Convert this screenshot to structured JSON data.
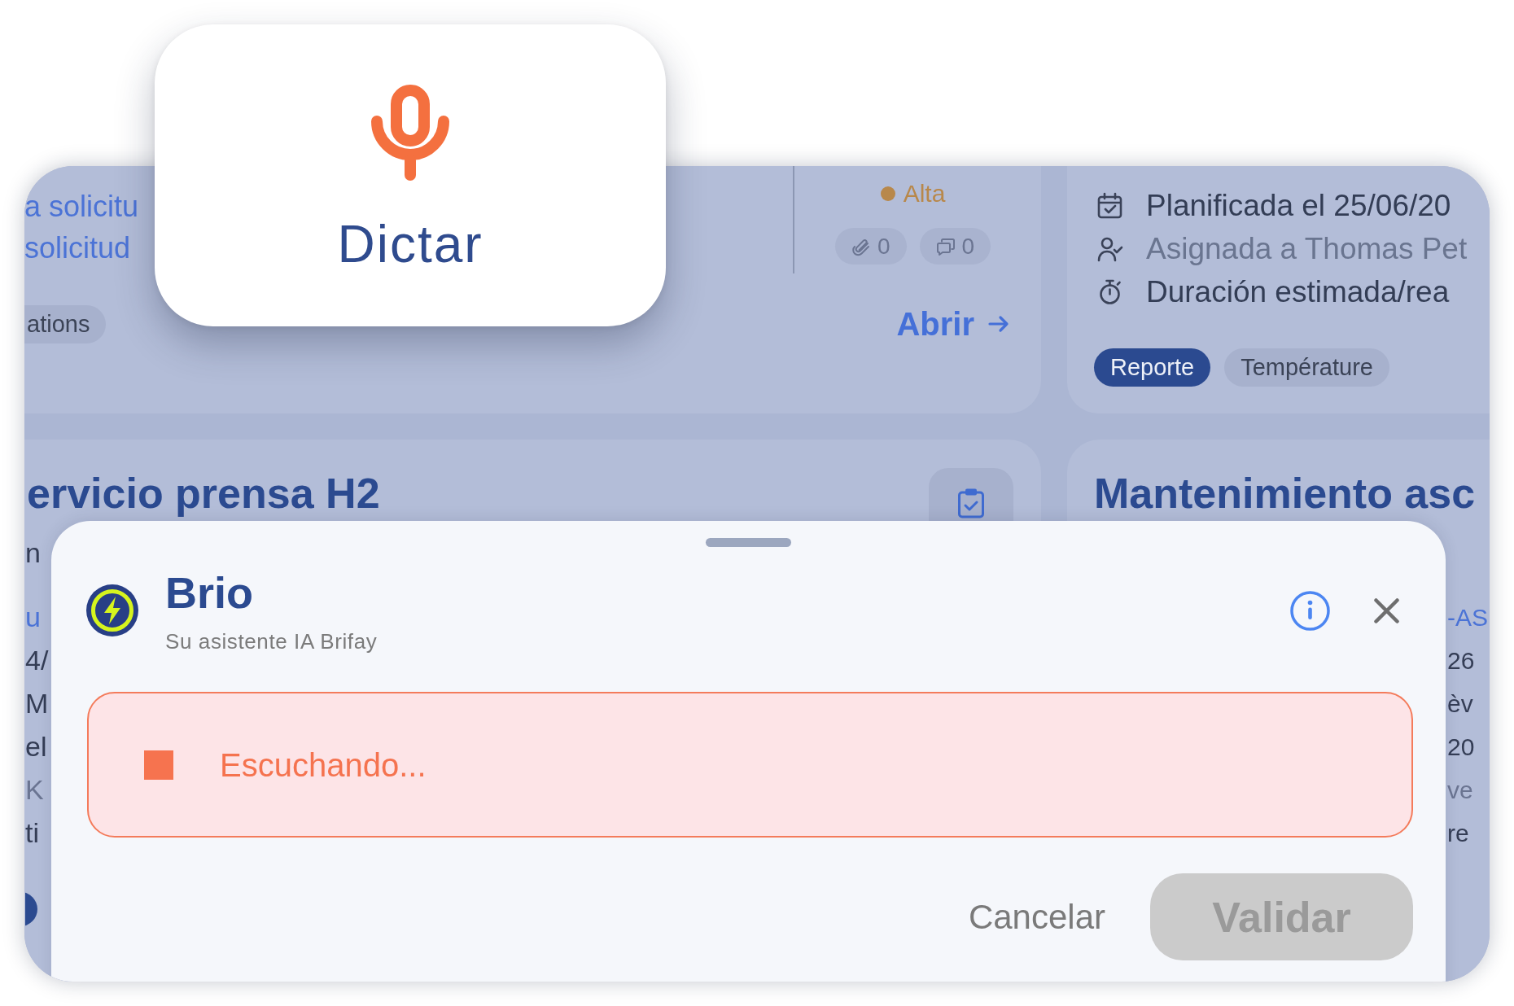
{
  "dictate_button": {
    "label": "Dictar"
  },
  "background_cards": {
    "top_left": {
      "links": [
        "a solicitu",
        "solicitud"
      ],
      "tags": [
        "ations"
      ],
      "priority": {
        "label": "Alta",
        "color": "#b8884b"
      },
      "counters": [
        {
          "kind": "attachments",
          "count": "0"
        },
        {
          "kind": "comments",
          "count": "0"
        }
      ],
      "open_link": "Abrir"
    },
    "top_right": {
      "details": [
        {
          "kind": "planned",
          "text": "Planificada el 25/06/20"
        },
        {
          "kind": "assignee",
          "text": "Asignada a Thomas Pet"
        },
        {
          "kind": "duration",
          "text": "Duración estimada/rea"
        }
      ],
      "tags": [
        {
          "label": "Reporte",
          "color": "#2b4a90"
        },
        {
          "label": "Température",
          "color": "#a7b1cd"
        }
      ]
    },
    "bottom_left": {
      "title": "ervicio prensa H2",
      "subtitle": "n",
      "lines": [
        {
          "kind": "link",
          "text": "u"
        },
        {
          "kind": "text",
          "text": "4/"
        },
        {
          "kind": "text",
          "text": "M"
        },
        {
          "kind": "text",
          "text": "el"
        },
        {
          "kind": "muted",
          "text": "K"
        },
        {
          "kind": "text",
          "text": "ti"
        }
      ]
    },
    "bottom_right": {
      "title": "Mantenimiento asc",
      "lines": [
        {
          "kind": "link",
          "text": "-AS"
        },
        {
          "kind": "text",
          "text": "26"
        },
        {
          "kind": "text",
          "text": "èv"
        },
        {
          "kind": "text",
          "text": "20"
        },
        {
          "kind": "muted",
          "text": "ve"
        },
        {
          "kind": "text",
          "text": "re"
        }
      ]
    }
  },
  "assistant_sheet": {
    "name": "Brio",
    "subtitle": "Su asistente IA Brifay",
    "dictation": {
      "recording": true,
      "status": "Escuchando..."
    },
    "actions": [
      {
        "kind": "cancel",
        "label": "Cancelar",
        "disabled": false
      },
      {
        "kind": "confirm",
        "label": "Validar",
        "disabled": true
      }
    ]
  }
}
